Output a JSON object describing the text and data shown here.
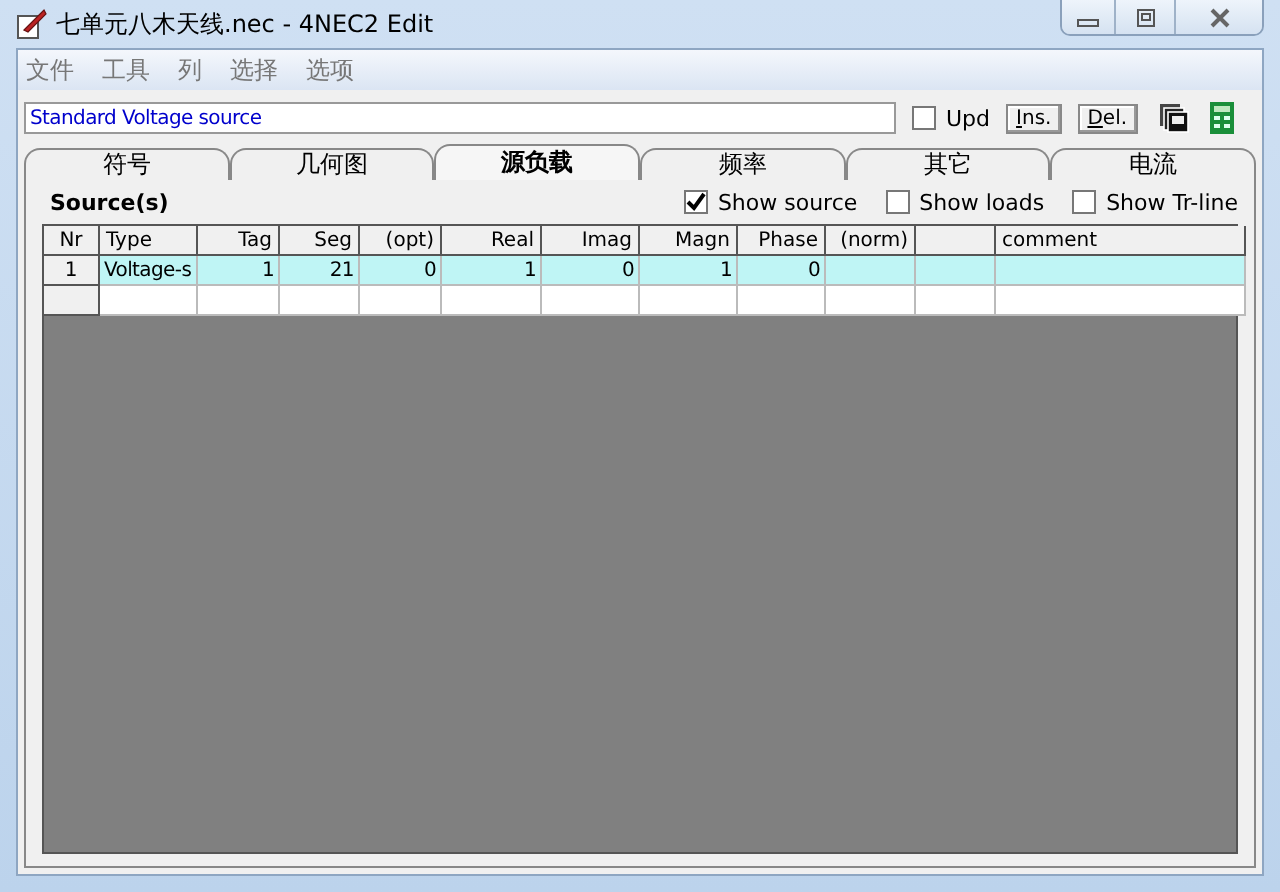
{
  "window": {
    "title": "七单元八木天线.nec - 4NEC2 Edit"
  },
  "menu": [
    "文件",
    "工具",
    "列",
    "选择",
    "选项"
  ],
  "comment_field": {
    "value": "Standard Voltage source"
  },
  "upd": {
    "label": "Upd",
    "checked": false
  },
  "buttons": [
    "Ins.",
    "Del."
  ],
  "tabs": [
    {
      "label": "符号",
      "selected": false
    },
    {
      "label": "几何图",
      "selected": false
    },
    {
      "label": "源负载",
      "selected": true
    },
    {
      "label": "频率",
      "selected": false
    },
    {
      "label": "其它",
      "selected": false
    },
    {
      "label": "电流",
      "selected": false
    }
  ],
  "section_title": "Source(s)",
  "options": [
    {
      "label": "Show source",
      "checked": true
    },
    {
      "label": "Show loads",
      "checked": false
    },
    {
      "label": "Show Tr-line",
      "checked": false
    }
  ],
  "table": {
    "columns": [
      {
        "label": "Nr"
      },
      {
        "label": "Type"
      },
      {
        "label": "Tag"
      },
      {
        "label": "Seg"
      },
      {
        "label": "(opt)"
      },
      {
        "label": "Real"
      },
      {
        "label": "Imag"
      },
      {
        "label": "Magn"
      },
      {
        "label": "Phase"
      },
      {
        "label": "(norm)"
      },
      {},
      {
        "label": "comment"
      }
    ],
    "rows": [
      {
        "selected": true,
        "cells": [
          "1",
          "Voltage-s",
          "1",
          "21",
          "0",
          "1",
          "0",
          "1",
          "0"
        ]
      }
    ]
  }
}
